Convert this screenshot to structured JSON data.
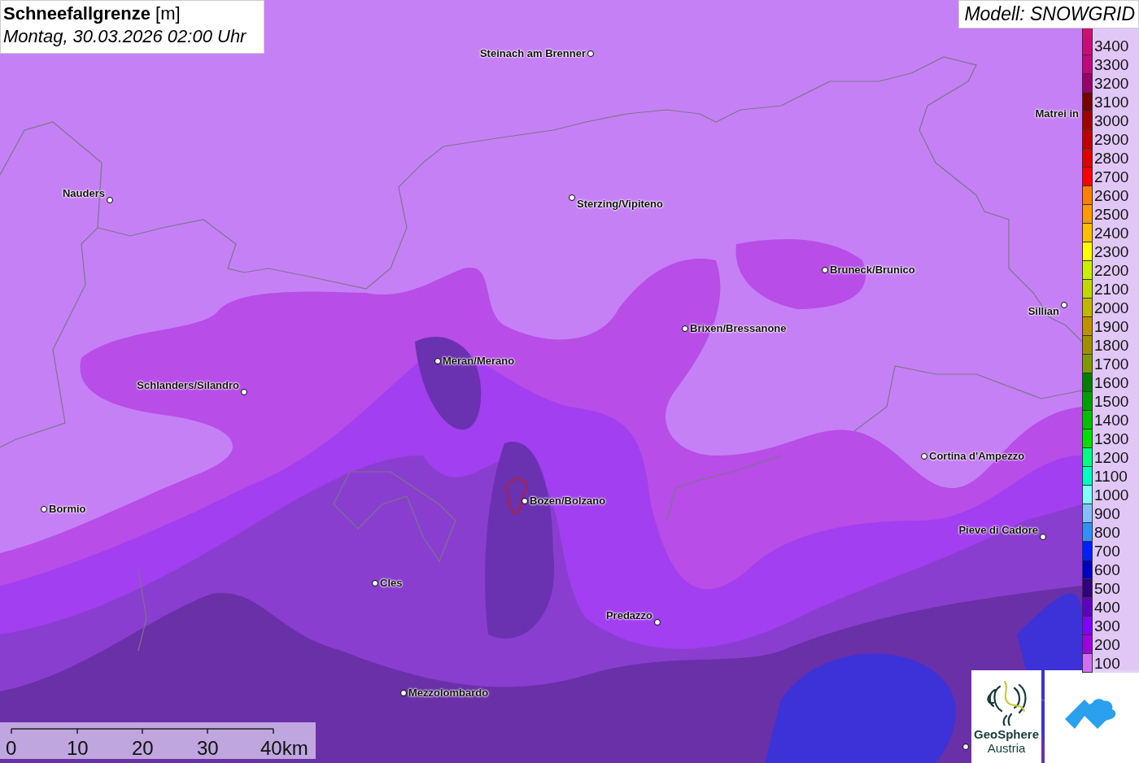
{
  "header": {
    "title": "**Schneefallgrenze** [m]",
    "subtitle": "Montag, 30.03.2026 02:00 Uhr"
  },
  "model": "Modell: SNOWGRID",
  "legend": [
    {
      "label": "3400",
      "color": "#cc0a7a"
    },
    {
      "label": "3300",
      "color": "#c0087a"
    },
    {
      "label": "3200",
      "color": "#99006a"
    },
    {
      "label": "3100",
      "color": "#7a0000"
    },
    {
      "label": "3000",
      "color": "#a00000"
    },
    {
      "label": "2900",
      "color": "#c00000"
    },
    {
      "label": "2800",
      "color": "#e00000"
    },
    {
      "label": "2700",
      "color": "#ff0000"
    },
    {
      "label": "2600",
      "color": "#ff7f00"
    },
    {
      "label": "2500",
      "color": "#ff9a00"
    },
    {
      "label": "2400",
      "color": "#ffbf00"
    },
    {
      "label": "2300",
      "color": "#ffff00"
    },
    {
      "label": "2200",
      "color": "#c8f000"
    },
    {
      "label": "2100",
      "color": "#c0d800"
    },
    {
      "label": "2000",
      "color": "#c0b800"
    },
    {
      "label": "1900",
      "color": "#c09000"
    },
    {
      "label": "1800",
      "color": "#a09000"
    },
    {
      "label": "1700",
      "color": "#7f9a00"
    },
    {
      "label": "1600",
      "color": "#007f00"
    },
    {
      "label": "1500",
      "color": "#00a000"
    },
    {
      "label": "1400",
      "color": "#00c000"
    },
    {
      "label": "1300",
      "color": "#00e000"
    },
    {
      "label": "1200",
      "color": "#00ff80"
    },
    {
      "label": "1100",
      "color": "#00ffc0"
    },
    {
      "label": "1000",
      "color": "#80ffff"
    },
    {
      "label": "900",
      "color": "#80c0ff"
    },
    {
      "label": "800",
      "color": "#3090ff"
    },
    {
      "label": "700",
      "color": "#0020ff"
    },
    {
      "label": "600",
      "color": "#0000c0"
    },
    {
      "label": "500",
      "color": "#300080"
    },
    {
      "label": "400",
      "color": "#6000c0"
    },
    {
      "label": "300",
      "color": "#8000ff"
    },
    {
      "label": "200",
      "color": "#a000e0"
    },
    {
      "label": "100",
      "color": "#d070f0"
    }
  ],
  "cities": [
    {
      "name": "Steinach am Brenner"
    },
    {
      "name": "Matrei in"
    },
    {
      "name": "Nauders"
    },
    {
      "name": "Sterzing/Vipiteno"
    },
    {
      "name": "Bruneck/Brunico"
    },
    {
      "name": "Sillian"
    },
    {
      "name": "Brixen/Bressanone"
    },
    {
      "name": "Meran/Merano"
    },
    {
      "name": "Schlanders/Silandro"
    },
    {
      "name": "Cortina d'Ampezzo"
    },
    {
      "name": "Bormio"
    },
    {
      "name": "Bozen/Bolzano"
    },
    {
      "name": "Pieve di Cadore"
    },
    {
      "name": "Cles"
    },
    {
      "name": "Predazzo"
    },
    {
      "name": "Mezzolombardo"
    }
  ],
  "scale_bar": [
    "0",
    "10",
    "20",
    "30",
    "40km"
  ],
  "logo": {
    "name": "GeoSphere",
    "subtitle": "Austria"
  }
}
